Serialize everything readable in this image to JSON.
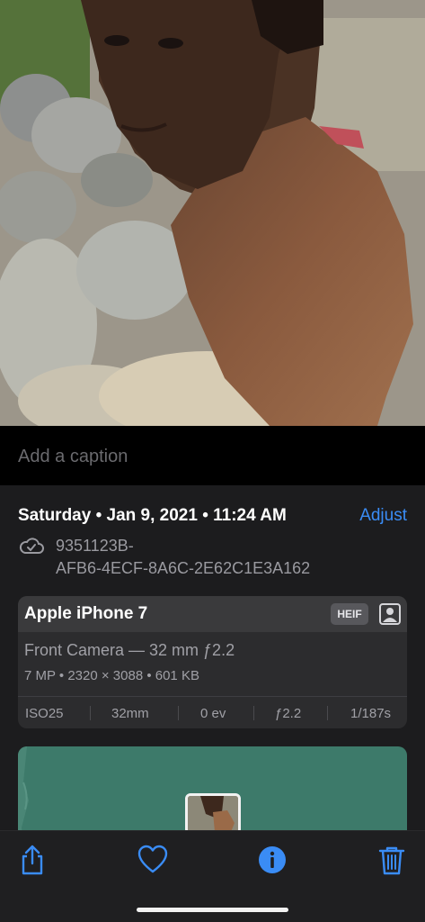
{
  "photo": {
    "description_icon": "photo-image"
  },
  "caption": {
    "placeholder": "Add a caption",
    "value": ""
  },
  "info": {
    "date": "Saturday • Jan 9, 2021 • 11:24 AM",
    "adjust_label": "Adjust",
    "file_name_line1": "9351123B-",
    "file_name_line2": "AFB6-4ECF-8A6C-2E62C1E3A162",
    "cloud_icon": "cloud-check-icon"
  },
  "camera": {
    "device": "Apple iPhone 7",
    "format_badge": "HEIF",
    "lens": "Front Camera — 32 mm ƒ2.2",
    "specs": "7 MP  •  2320 × 3088  •  601 KB",
    "exif": {
      "iso": "ISO25",
      "focal": "32mm",
      "ev": "0 ev",
      "aperture": "ƒ2.2",
      "shutter": "1/187s"
    },
    "portrait_icon": "portrait-icon"
  },
  "map": {
    "thumb_icon": "photo-thumbnail"
  },
  "toolbar": {
    "share_icon": "share-icon",
    "favorite_icon": "heart-icon",
    "info_icon": "info-icon",
    "delete_icon": "trash-icon"
  },
  "colors": {
    "accent": "#3a8cf5",
    "panel": "#1c1c1e",
    "card": "#2c2c2e",
    "map": "#3d7a6a"
  }
}
